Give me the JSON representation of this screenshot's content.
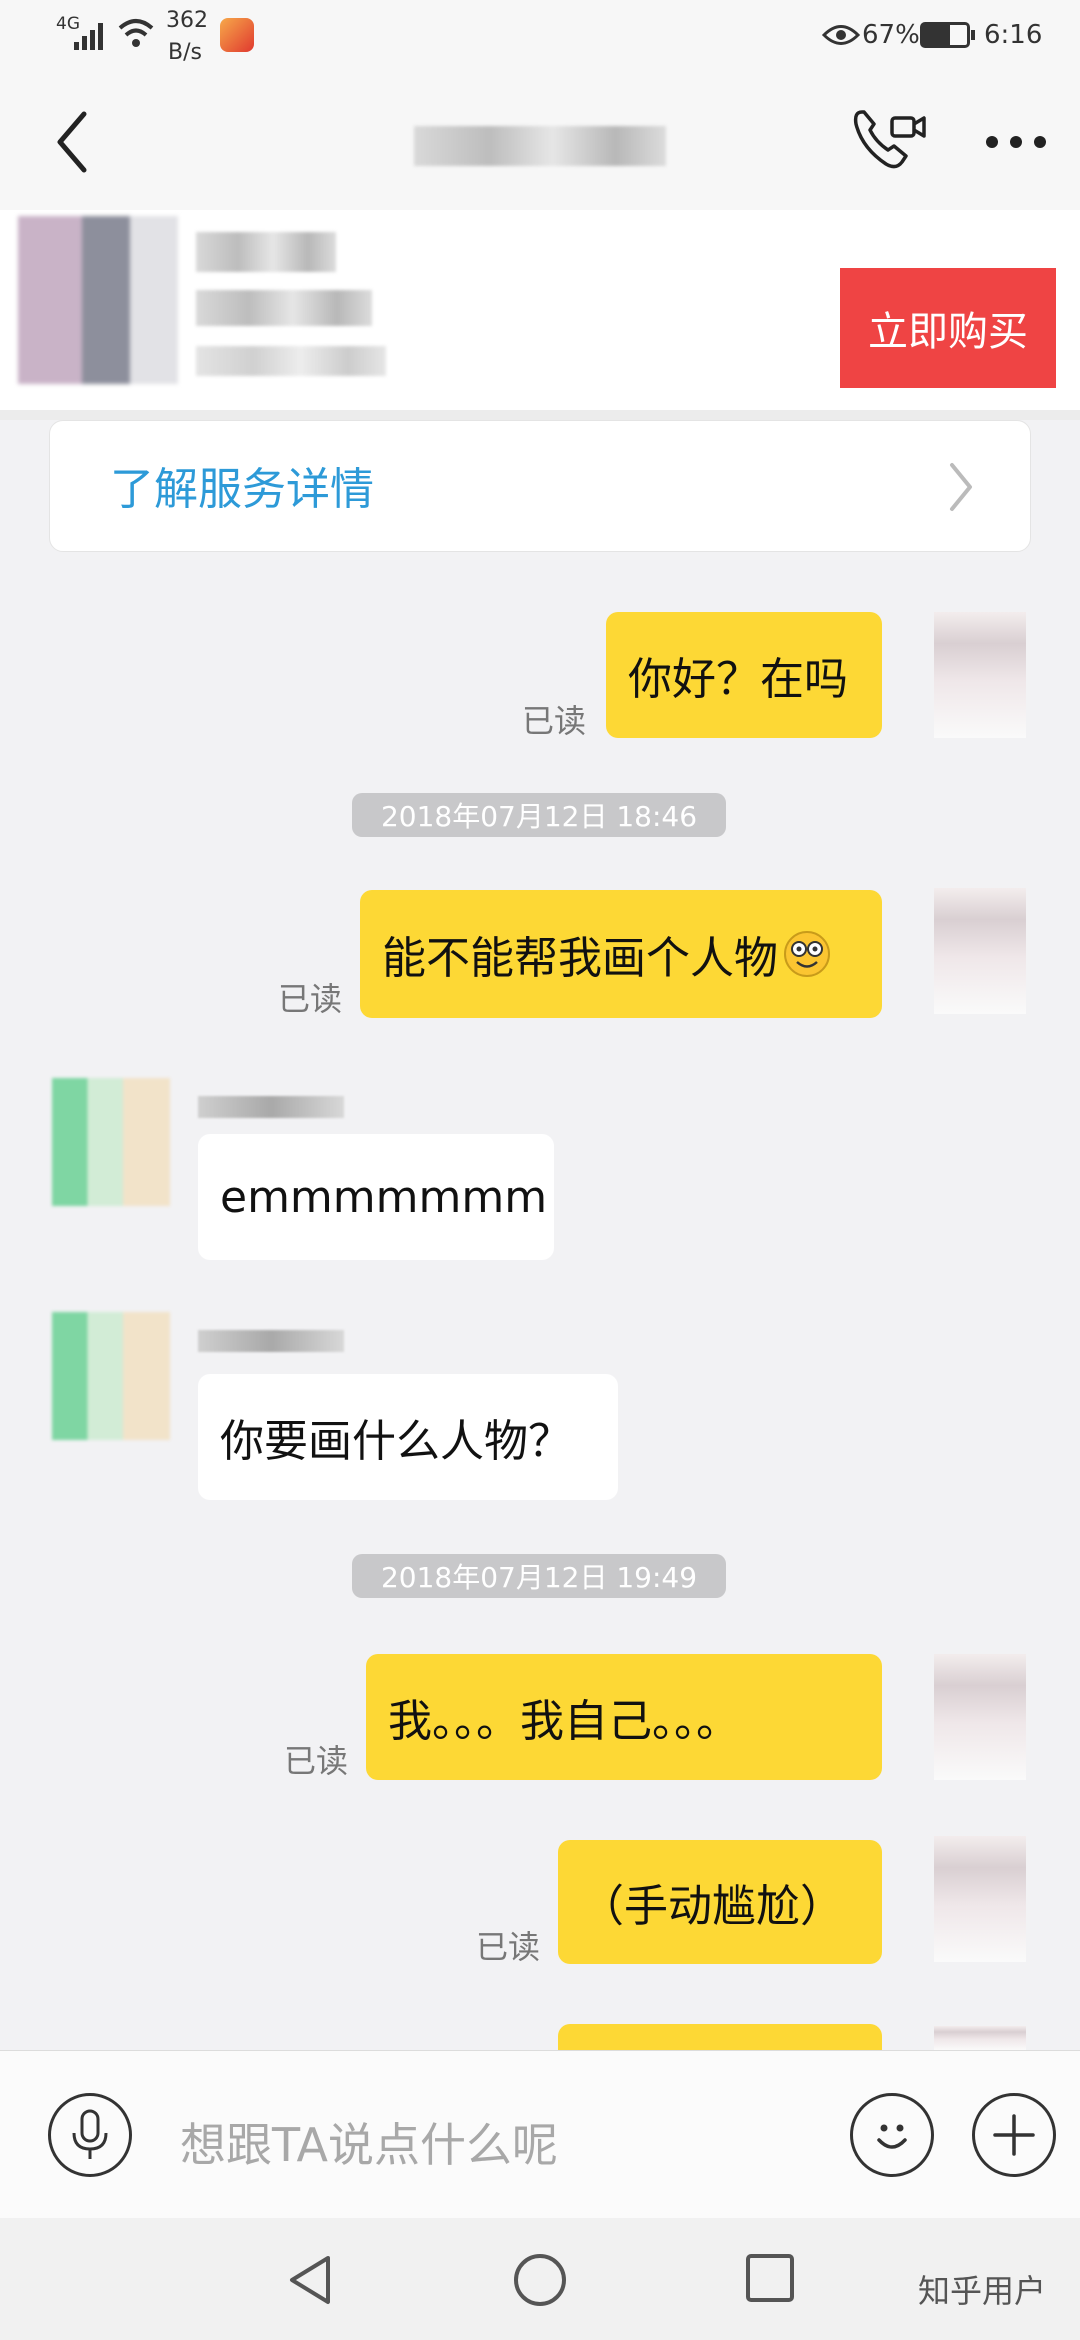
{
  "status_bar": {
    "network": "4G",
    "speed_value": "362",
    "speed_unit": "B/s",
    "battery": "67%",
    "time": "6:16"
  },
  "header": {
    "back_icon": "chevron-left-icon",
    "call_icon": "video-call-icon",
    "more_icon": "more-dots-icon"
  },
  "product": {
    "buy_label": "立即购买"
  },
  "service": {
    "label": "了解服务详情"
  },
  "messages": {
    "m1": {
      "text": "你好？在吗",
      "status": "已读"
    },
    "ts1": "2018年07月12日 18:46",
    "m2": {
      "text": "能不能帮我画个人物",
      "status": "已读"
    },
    "m3": {
      "text": "emmmmmmm"
    },
    "m4": {
      "text": "你要画什么人物？"
    },
    "ts2": "2018年07月12日 19:49",
    "m5": {
      "text": "我。。。我自己。。。",
      "status": "已读"
    },
    "m6": {
      "text": "（手动尴尬）",
      "status": "已读"
    }
  },
  "input": {
    "placeholder": "想跟TA说点什么呢"
  },
  "nav": {
    "watermark": "知乎用户"
  },
  "colors": {
    "outgoing_bubble": "#fdd835",
    "buy_button": "#ef4444",
    "service_link": "#2d9ad8"
  }
}
